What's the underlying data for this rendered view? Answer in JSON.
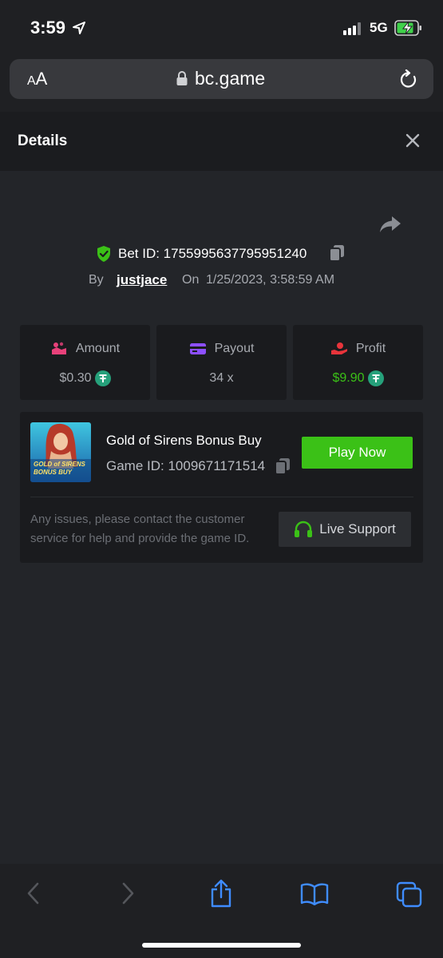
{
  "status_bar": {
    "time": "3:59",
    "network": "5G",
    "icons": [
      "location-arrow-icon",
      "signal-bars-icon",
      "battery-charging-icon"
    ]
  },
  "browser": {
    "text_size_small": "A",
    "text_size_large": "A",
    "url": "bc.game"
  },
  "details": {
    "title": "Details"
  },
  "bet": {
    "bet_id_label": "Bet ID: 1755995637795951240",
    "by_label": "By",
    "username": "justjace",
    "on_label": "On",
    "datetime": "1/25/2023, 3:58:59 AM"
  },
  "stats": [
    {
      "label": "Amount",
      "value": "$0.30",
      "icon": "amount-icon",
      "color": "#e8417a"
    },
    {
      "label": "Payout",
      "value": "34 x",
      "icon": "payout-card-icon",
      "color": "#8d4fff"
    },
    {
      "label": "Profit",
      "value": "$9.90",
      "icon": "profit-hand-icon",
      "color": "#e8343b"
    }
  ],
  "game": {
    "thumbnail_lines": [
      "GOLD of SIRENS",
      "BONUS BUY"
    ],
    "name": "Gold of Sirens Bonus Buy",
    "game_id": "Game ID: 1009671171514",
    "play_button": "Play Now",
    "issues_text": "Any issues, please contact the customer service for help and provide the game ID.",
    "support_button": "Live Support"
  },
  "colors": {
    "background": "#232529",
    "card": "#1a1b1e",
    "accent_green": "#3bc117",
    "tether": "#26a17b"
  }
}
